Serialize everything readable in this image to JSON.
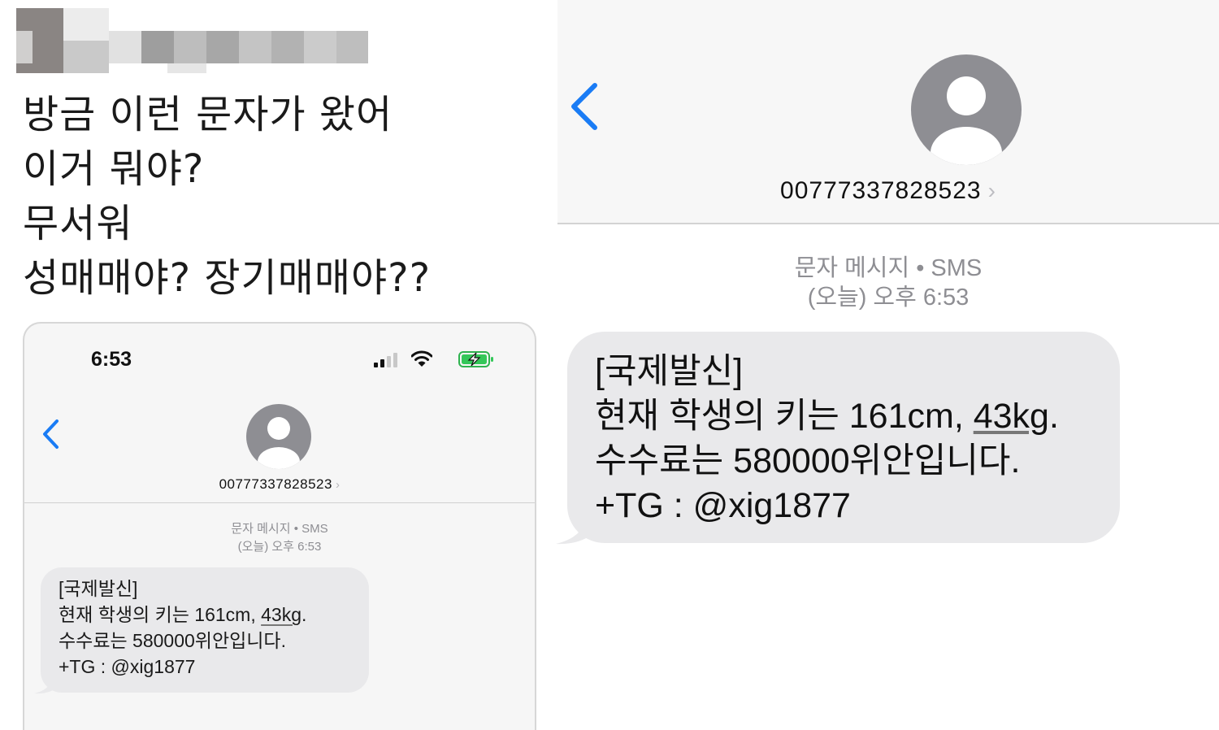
{
  "post": {
    "lines": [
      "방금 이런 문자가 왔어",
      "이거 뭐야?",
      "무서워",
      "성매매야? 장기매매야??"
    ]
  },
  "phone": {
    "status_time": "6:53",
    "icons": [
      "signal-icon",
      "wifi-icon",
      "battery-charging-icon"
    ]
  },
  "conversation": {
    "back_icon": "chevron-left-icon",
    "avatar_icon": "person-avatar-icon",
    "contact_number": "00777337828523",
    "contact_chevron": "›",
    "meta_type": "문자 메시지 • SMS",
    "meta_time": "(오늘) 오후 6:53",
    "message": {
      "line1": "[국제발신]",
      "line2_a": "현재 학생의 키는 161cm, ",
      "line2_b": "43kg",
      "line2_c": ".",
      "line3": "수수료는 580000위안입니다.",
      "line4": "+TG : @xig1877"
    }
  },
  "colors": {
    "ios_blue": "#1a7cf5",
    "bubble_gray": "#e9e9eb",
    "meta_gray": "#8e8e93",
    "avatar_gray": "#8e8e93",
    "battery_green": "#34c759"
  }
}
